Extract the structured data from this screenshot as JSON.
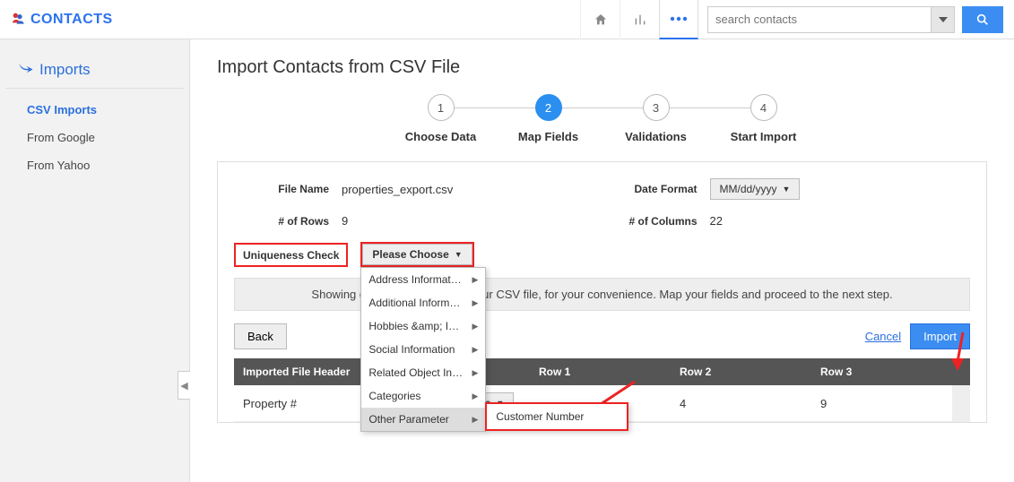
{
  "app": {
    "title": "CONTACTS"
  },
  "search": {
    "placeholder": "search contacts"
  },
  "sidebar": {
    "heading": "Imports",
    "items": [
      "CSV Imports",
      "From Google",
      "From Yahoo"
    ]
  },
  "page": {
    "title": "Import Contacts from CSV File",
    "steps": [
      "Choose Data",
      "Map Fields",
      "Validations",
      "Start Import"
    ],
    "active_step_index": 1
  },
  "file": {
    "name_label": "File Name",
    "name_value": "properties_export.csv",
    "rows_label": "# of Rows",
    "rows_value": "9",
    "date_format_label": "Date Format",
    "date_format_value": "MM/dd/yyyy",
    "cols_label": "# of Columns",
    "cols_value": "22"
  },
  "uniqueness": {
    "label": "Uniqueness Check",
    "choose_label": "Please Choose",
    "menu": [
      "Address Informat…",
      "Additional Inform…",
      "Hobbies &amp; I…",
      "Social Information",
      "Related Object In…",
      "Categories",
      "Other Parameter"
    ],
    "submenu_item": "Customer Number"
  },
  "info_bar": "Showing only first 3 rows from your CSV file, for your convenience. Map your fields and proceed to the next step.",
  "actions": {
    "back": "Back",
    "cancel": "Cancel",
    "import": "Import"
  },
  "table": {
    "headers": [
      "Imported File Header",
      "",
      "Row 1",
      "Row 2",
      "Row 3"
    ],
    "row0_header": "Property #",
    "row0_select": "Please Choose",
    "row0_cells": [
      "",
      "4",
      "9"
    ]
  }
}
